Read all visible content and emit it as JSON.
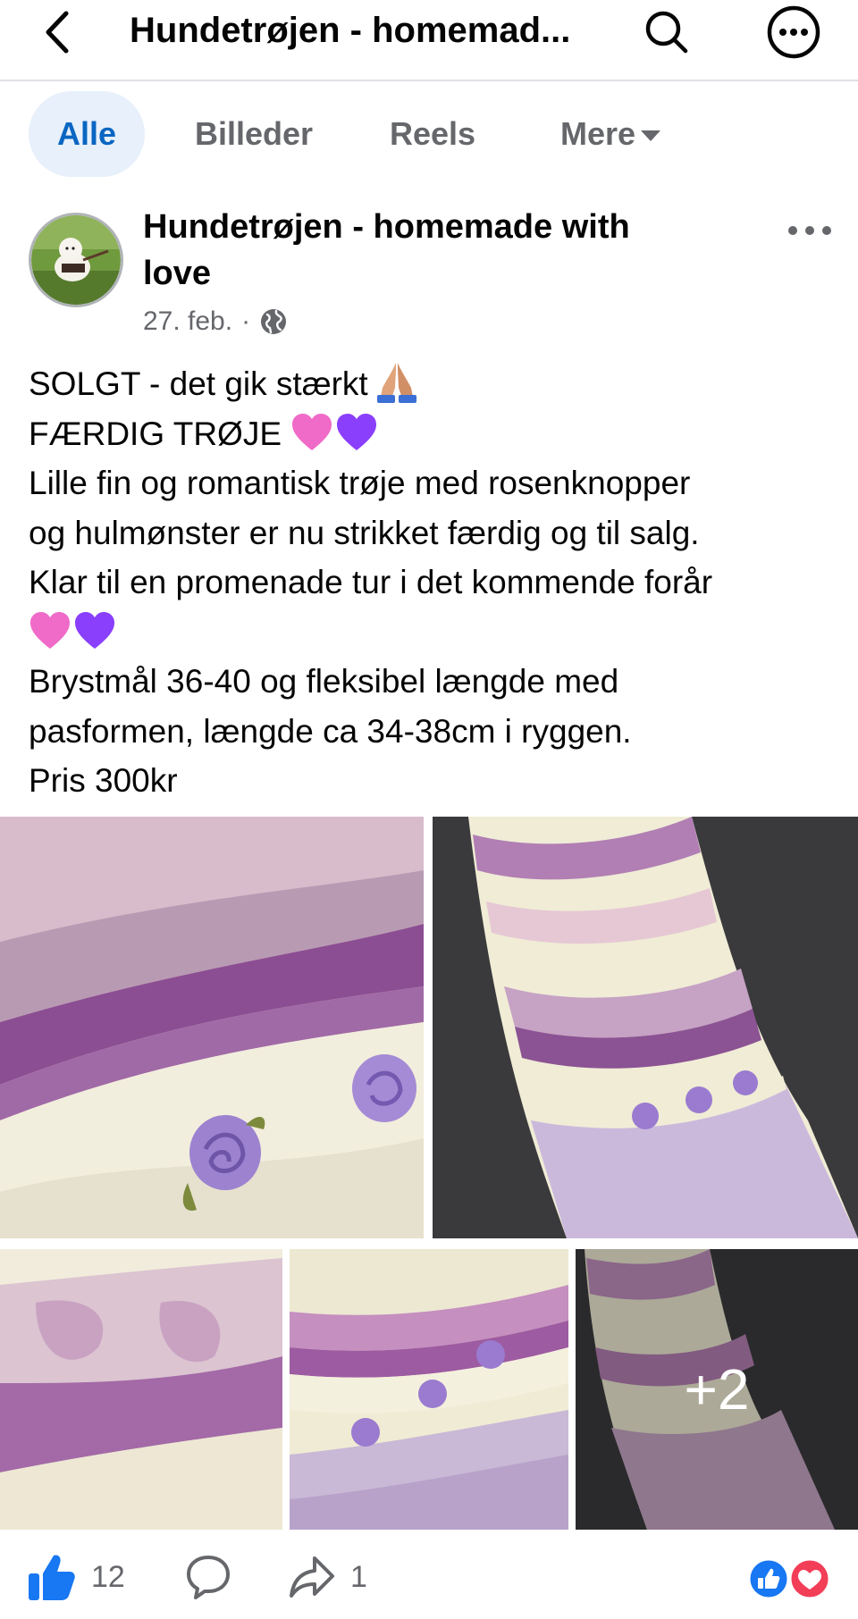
{
  "header": {
    "title": "Hundetrøjen - homemad...",
    "back_icon": "chevron-left-icon",
    "search_icon": "search-icon",
    "more_icon": "more-circle-icon"
  },
  "tabs": [
    {
      "label": "Alle",
      "active": true
    },
    {
      "label": "Billeder",
      "active": false
    },
    {
      "label": "Reels",
      "active": false
    },
    {
      "label": "Mere",
      "active": false,
      "has_dropdown": true
    }
  ],
  "post": {
    "page_name": "Hundetrøjen - homemade with love",
    "date": "27. feb.",
    "separator": "·",
    "audience_icon": "globe-icon",
    "lines": [
      "SOLGT - det gik stærkt",
      "FÆRDIG TRØJE",
      "Lille fin og romantisk trøje med rosenknopper",
      "og hulmønster er nu strikket færdig og til salg.",
      "Klar til en promenade tur i det kommende forår",
      "",
      "Brystmål 36-40 og fleksibel længde med",
      "pasformen, længde ca 34-38cm i ryggen.",
      "Pris 300kr"
    ],
    "more_photos": "+2"
  },
  "footer": {
    "like_count": "12",
    "share_count": "1"
  },
  "colors": {
    "accent": "#0a66c2",
    "tab_active_bg": "#e7f0fb",
    "secondary_text": "#65676b",
    "like_blue": "#1877f2",
    "love_red": "#f33e58",
    "pink_heart": "#f06bc8",
    "purple_heart": "#8a3ffc"
  }
}
